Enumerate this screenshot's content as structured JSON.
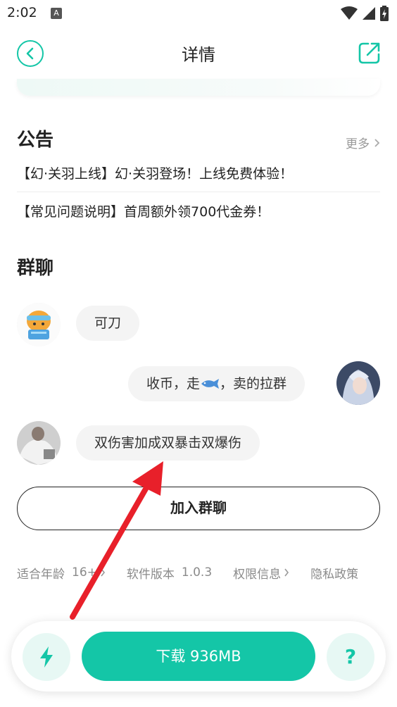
{
  "status": {
    "time": "2:02",
    "badge": "A"
  },
  "header": {
    "title": "详情"
  },
  "notices": {
    "title": "公告",
    "more": "更多",
    "items": [
      {
        "tag": "【幻·关羽上线】",
        "text": "幻·关羽登场！上线免费体验！"
      },
      {
        "tag": "【常见问题说明】",
        "text": "首周额外领700代金券！"
      }
    ]
  },
  "group": {
    "title": "群聊",
    "messages": [
      {
        "side": "left",
        "text": "可刀"
      },
      {
        "side": "right",
        "text_before": "收币，走",
        "text_after": "，卖的拉群",
        "icon": "fish-icon"
      },
      {
        "side": "left",
        "text": "双伤害加成双暴击双爆伤"
      }
    ],
    "join_label": "加入群聊"
  },
  "info": {
    "age_label": "适合年龄",
    "age_value": "16+",
    "version_label": "软件版本",
    "version_value": "1.0.3",
    "permission_label": "权限信息",
    "privacy_label": "隐私政策"
  },
  "bottom": {
    "download_label": "下载 936MB",
    "help_label": "?"
  },
  "colors": {
    "accent": "#14c6a7",
    "arrow": "#e8202a"
  }
}
